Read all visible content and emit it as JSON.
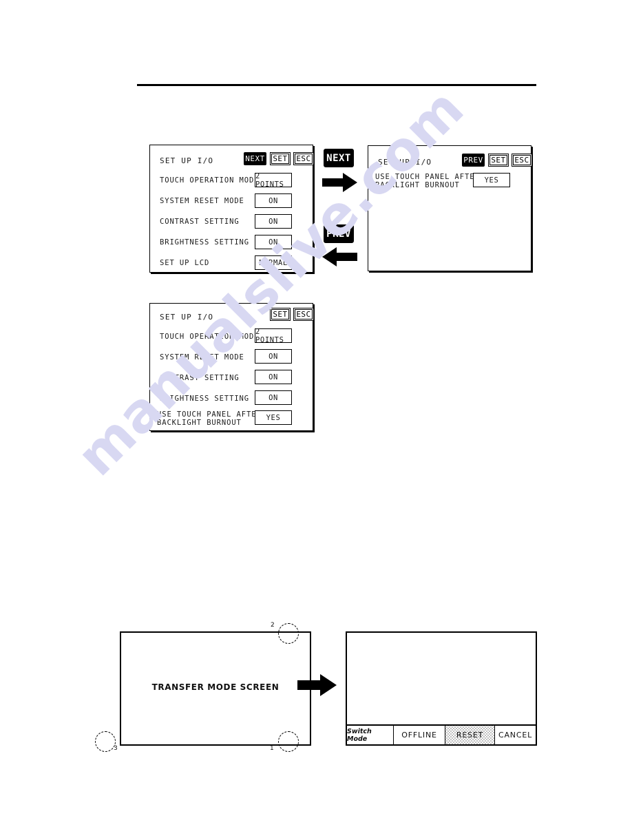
{
  "watermark": {
    "text": "manualslive.com"
  },
  "panel_setup_io_page1": {
    "title": "SET UP I/O",
    "commands": [
      {
        "label": "NEXT",
        "style": "inverted"
      },
      {
        "label": "SET",
        "style": "normal"
      },
      {
        "label": "ESC",
        "style": "normal"
      }
    ],
    "rows": [
      {
        "label": "TOUCH OPERATION MODE",
        "value": "2 POINTS"
      },
      {
        "label": "SYSTEM RESET MODE",
        "value": "ON"
      },
      {
        "label": "CONTRAST SETTING",
        "value": "ON"
      },
      {
        "label": "BRIGHTNESS SETTING",
        "value": "ON"
      },
      {
        "label": "SET UP LCD",
        "value": "NORMAL"
      }
    ]
  },
  "nav": {
    "next_label": "NEXT",
    "prev_label": "PREV",
    "next_arrow_icon": "arrow-right-icon",
    "prev_arrow_icon": "arrow-left-icon"
  },
  "panel_setup_io_page2": {
    "title": "SET UP I/O",
    "commands": [
      {
        "label": "PREV",
        "style": "inverted"
      },
      {
        "label": "SET",
        "style": "normal"
      },
      {
        "label": "ESC",
        "style": "normal"
      }
    ],
    "rows": [
      {
        "label_line1": "USE TOUCH PANEL AFTER",
        "label_line2": "BACKLIGHT BURNOUT",
        "value": "YES"
      }
    ]
  },
  "panel_setup_io_combined": {
    "title": "SET UP I/O",
    "commands": [
      {
        "label": "SET",
        "style": "normal"
      },
      {
        "label": "ESC",
        "style": "normal"
      }
    ],
    "rows": [
      {
        "label": "TOUCH OPERATION MODE",
        "value": "2 POINTS"
      },
      {
        "label": "SYSTEM RESET MODE",
        "value": "ON"
      },
      {
        "label": "CONTRAST SETTING",
        "value": "ON"
      },
      {
        "label": "BRIGHTNESS SETTING",
        "value": "ON"
      },
      {
        "label_line1": "USE TOUCH PANEL AFTER",
        "label_line2": "BACKLIGHT BURNOUT",
        "value": "YES"
      }
    ]
  },
  "transfer_diagram": {
    "screen_label": "TRANSFER MODE SCREEN",
    "corners": [
      {
        "num": "2",
        "position": "top-right"
      },
      {
        "num": "3",
        "position": "bottom-left"
      },
      {
        "num": "1",
        "position": "bottom-right"
      }
    ],
    "arrow_icon": "arrow-right-icon"
  },
  "mode_panel": {
    "bar": [
      {
        "label": "Switch Mode",
        "style": "italic"
      },
      {
        "label": "OFFLINE",
        "style": "plain"
      },
      {
        "label": "RESET",
        "style": "dotted"
      },
      {
        "label": "CANCEL",
        "style": "plain"
      }
    ]
  }
}
